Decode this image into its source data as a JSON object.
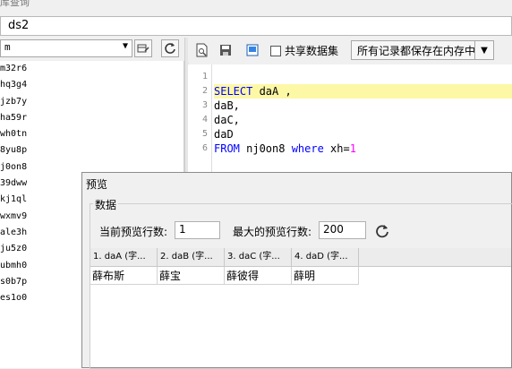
{
  "window": {
    "title": "库查询"
  },
  "name_field": {
    "value": "ds2"
  },
  "left_panel": {
    "combo_value": "m",
    "items": [
      "m32r6",
      "hq3g4",
      "jzb7y",
      "ha59r",
      "wh0tn",
      "8yu8p",
      "j0on8",
      "39dww",
      "kj1ql",
      "wxmv9",
      "ale3h",
      "ju5z0",
      "ubmh0",
      "s0b7p",
      "es1o0"
    ]
  },
  "toolbar": {
    "share_label": "共享数据集",
    "share_checked": false,
    "storage_mode": "所有记录都保存在内存中"
  },
  "editor": {
    "line_numbers": [
      "1",
      "2",
      "3",
      "4",
      "5",
      "6"
    ],
    "lines": [
      {
        "tokens": []
      },
      {
        "tokens": [
          {
            "t": "SELECT",
            "c": "kw"
          },
          {
            "t": " daA ,",
            "c": ""
          }
        ]
      },
      {
        "tokens": [
          {
            "t": "daB,",
            "c": ""
          }
        ]
      },
      {
        "tokens": [
          {
            "t": "daC,",
            "c": ""
          }
        ]
      },
      {
        "tokens": [
          {
            "t": "daD",
            "c": ""
          }
        ]
      },
      {
        "tokens": [
          {
            "t": "FROM",
            "c": "kw"
          },
          {
            "t": " nj0on8 ",
            "c": ""
          },
          {
            "t": "where",
            "c": "kw"
          },
          {
            "t": " xh=",
            "c": ""
          },
          {
            "t": "1",
            "c": "num"
          }
        ]
      }
    ]
  },
  "preview": {
    "title": "预览",
    "group_label": "数据",
    "current_rows_label": "当前预览行数:",
    "current_rows_value": "1",
    "max_rows_label": "最大的预览行数:",
    "max_rows_value": "200",
    "columns": [
      "1. daA (字...",
      "2. daB (字...",
      "3. daC (字...",
      "4. daD (字..."
    ],
    "rows": [
      [
        "薛布斯",
        "薛宝",
        "薛彼得",
        "薛明"
      ]
    ]
  }
}
